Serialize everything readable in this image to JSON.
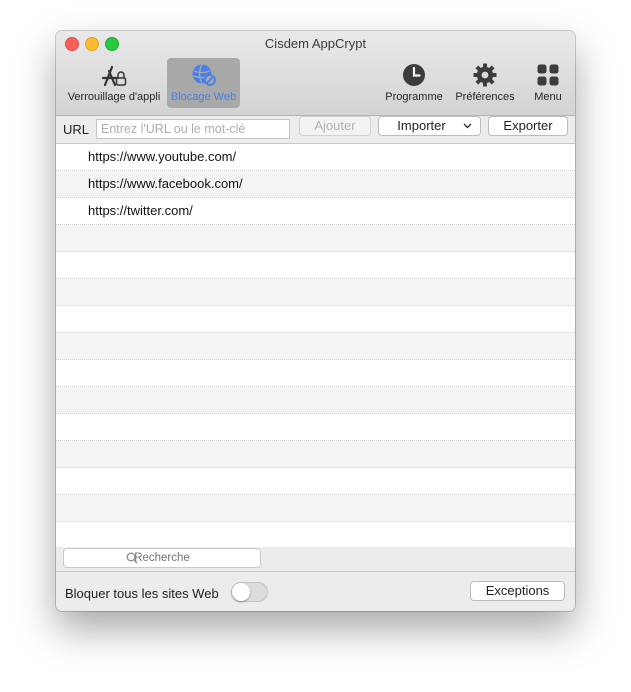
{
  "window": {
    "title": "Cisdem AppCrypt"
  },
  "toolbar": {
    "app_lock_label": "Verrouillage d'appli",
    "web_block_label": "Blocage Web",
    "schedule_label": "Programme",
    "preferences_label": "Préférences",
    "menu_label": "Menu",
    "active_tab": "web_block"
  },
  "urlbar": {
    "label": "URL",
    "placeholder": "Entrez l'URL ou le mot-clé",
    "add_label": "Ajouter",
    "import_label": "Importer",
    "export_label": "Exporter"
  },
  "list": {
    "items": [
      "https://www.youtube.com/",
      "https://www.facebook.com/",
      "https://twitter.com/"
    ]
  },
  "search": {
    "placeholder": "Recherche"
  },
  "bottom": {
    "block_all_label": "Bloquer tous les sites Web",
    "block_all_enabled": false,
    "exceptions_label": "Exceptions"
  },
  "colors": {
    "accent": "#4a7ee6",
    "active_tab_bg": "#a9a9a9"
  }
}
